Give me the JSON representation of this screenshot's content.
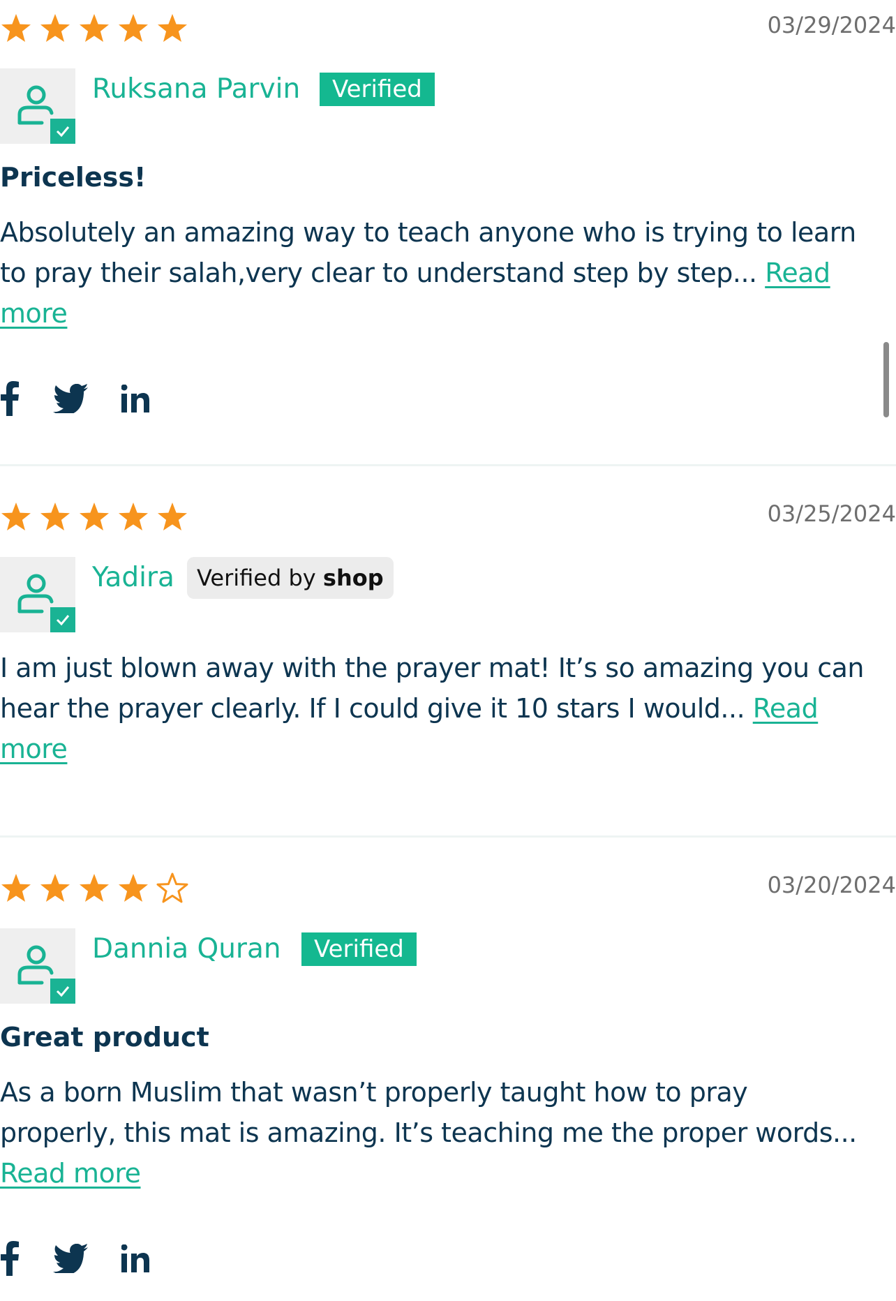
{
  "reviews": [
    {
      "rating": 5,
      "date": "03/29/2024",
      "name": "Ruksana Parvin",
      "badge": "Verified",
      "title": "Priceless!",
      "body_line1": "Absolutely an amazing way to teach anyone who is trying to learn",
      "body_line2": "to pray their salah,very clear to understand step by step... ",
      "read_more_part1": "Read",
      "read_more_part2": "more"
    },
    {
      "rating": 5,
      "date": "03/25/2024",
      "name": "Yadira",
      "badge_prefix": "Verified by ",
      "badge_brand": "shop",
      "body_line1": "I am just blown away with the prayer mat! It’s so amazing you can",
      "body_line2": "hear the prayer clearly. If I could give it 10 stars I would... ",
      "read_more_part1": "Read",
      "read_more_part2": "more"
    },
    {
      "rating": 4,
      "date": "03/20/2024",
      "name": "Dannia Quran",
      "badge": "Verified",
      "title": "Great product",
      "body_line1": "As a born Muslim that wasn’t properly taught how to pray",
      "body_line2": "properly, this mat is amazing. It’s teaching me the proper words...",
      "read_more": "Read more"
    }
  ],
  "social_icons": [
    "facebook-icon",
    "twitter-icon",
    "linkedin-icon"
  ],
  "colors": {
    "star": "#f7941d",
    "accent": "#19b394",
    "verified_bg": "#14b890",
    "text": "#0d3550",
    "date": "#6e6e6e"
  }
}
